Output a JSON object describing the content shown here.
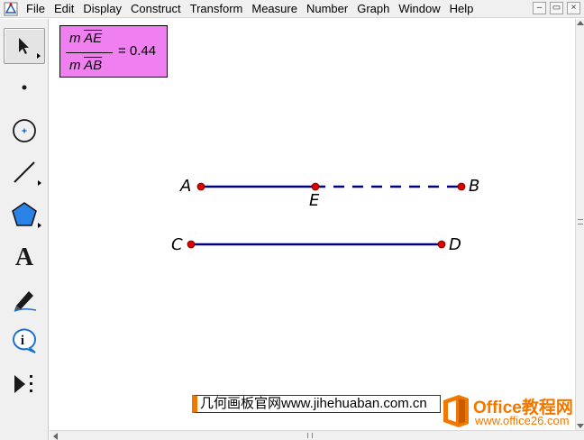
{
  "menu": [
    {
      "label": "File",
      "name": "menu-file"
    },
    {
      "label": "Edit",
      "name": "menu-edit"
    },
    {
      "label": "Display",
      "name": "menu-display"
    },
    {
      "label": "Construct",
      "name": "menu-construct"
    },
    {
      "label": "Transform",
      "name": "menu-transform"
    },
    {
      "label": "Measure",
      "name": "menu-measure"
    },
    {
      "label": "Number",
      "name": "menu-number"
    },
    {
      "label": "Graph",
      "name": "menu-graph"
    },
    {
      "label": "Window",
      "name": "menu-window"
    },
    {
      "label": "Help",
      "name": "menu-help"
    }
  ],
  "window_controls": {
    "minimize": "–",
    "restore": "▭",
    "close": "×"
  },
  "tools": [
    {
      "name": "arrow-tool",
      "icon": "arrow-icon",
      "selected": true
    },
    {
      "name": "point-tool",
      "icon": "point-icon"
    },
    {
      "name": "compass-tool",
      "icon": "compass-icon"
    },
    {
      "name": "straightedge-tool",
      "icon": "line-icon"
    },
    {
      "name": "polygon-tool",
      "icon": "polygon-icon"
    },
    {
      "name": "text-tool",
      "icon": "text-icon",
      "glyph": "A"
    },
    {
      "name": "marker-tool",
      "icon": "marker-icon"
    },
    {
      "name": "information-tool",
      "icon": "information-icon",
      "glyph": "i"
    },
    {
      "name": "custom-tool",
      "icon": "custom-tool-icon"
    }
  ],
  "measurement": {
    "numerator": "m AE",
    "denominator": "m AB",
    "m": "m",
    "num_segment": "AE",
    "den_segment": "AB",
    "equals": "= 0.44"
  },
  "points": {
    "A": "A",
    "B": "B",
    "C": "C",
    "D": "D",
    "E": "E"
  },
  "colors": {
    "segment": "#00007f",
    "point": "#e00000",
    "measure_bg": "#f080f0",
    "accent": "#f07800"
  },
  "watermark": {
    "text": "几何画板官网www.jihehuaban.com.cn"
  },
  "office_logo": {
    "brand": "Office教程网",
    "url": "www.office26.com"
  }
}
